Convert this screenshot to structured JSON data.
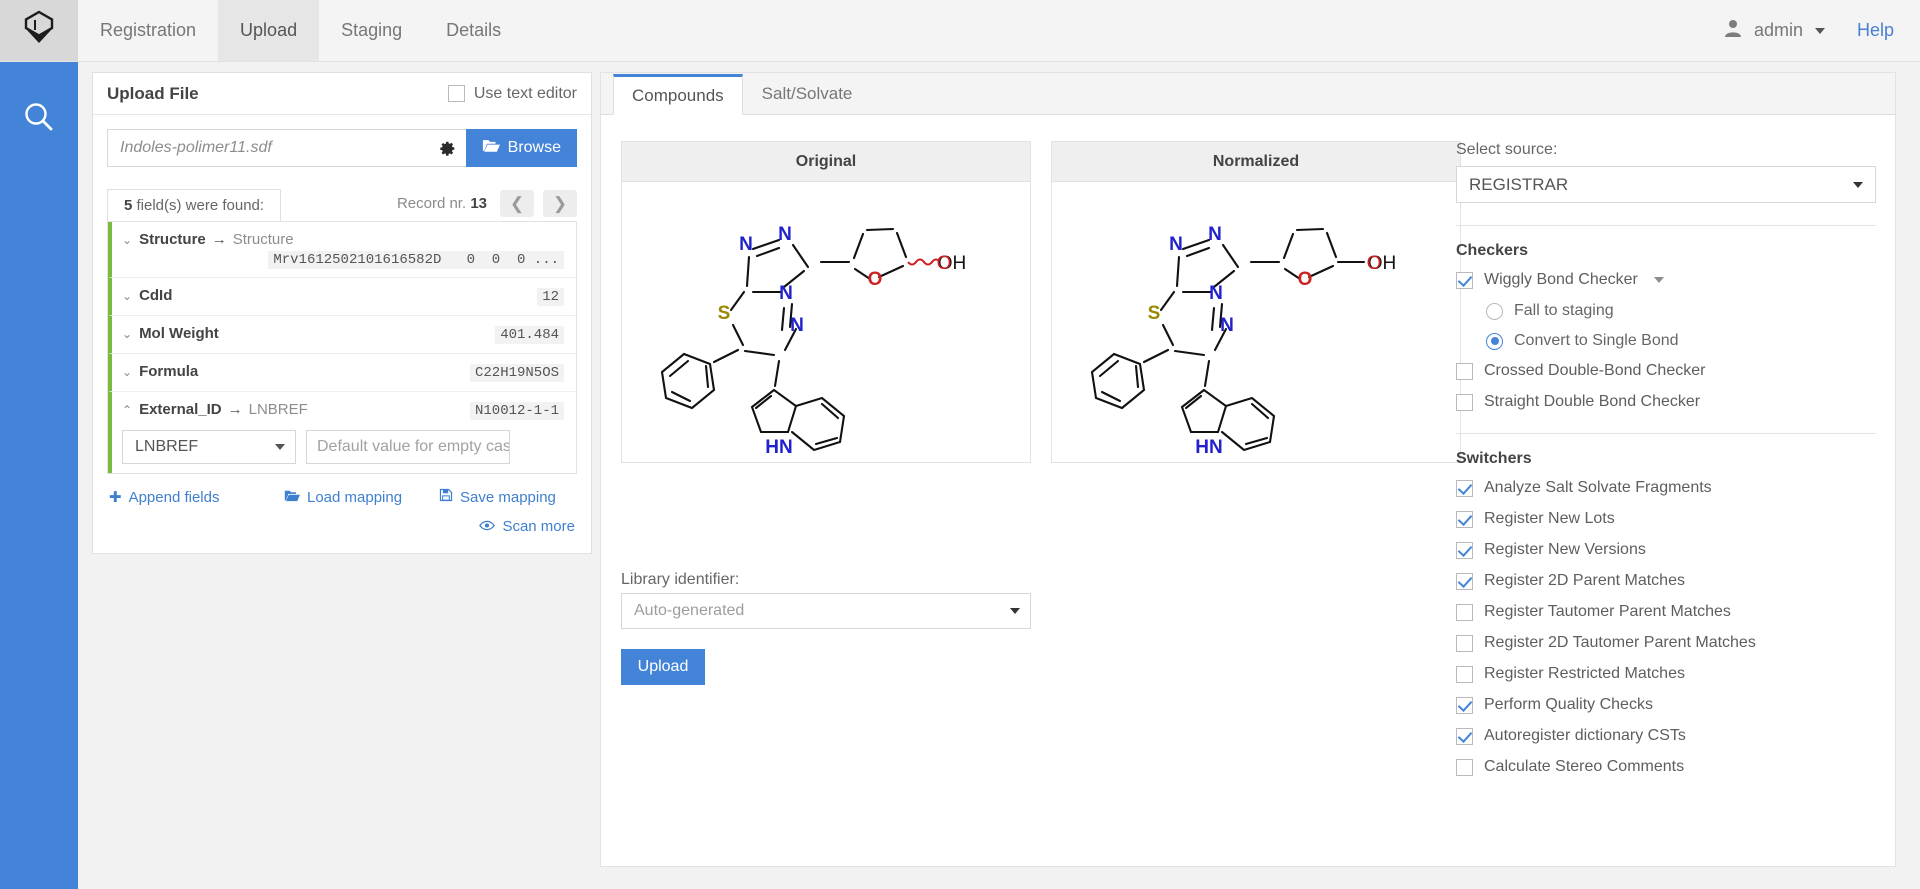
{
  "topbar": {
    "logo_icon": "cube-logo-icon",
    "nav": [
      {
        "label": "Registration",
        "active": false
      },
      {
        "label": "Upload",
        "active": true
      },
      {
        "label": "Staging",
        "active": false
      },
      {
        "label": "Details",
        "active": false
      }
    ],
    "user_icon": "person-icon",
    "user": "admin",
    "help": "Help"
  },
  "rail": {
    "search_icon": "search-icon"
  },
  "upload_card": {
    "title": "Upload File",
    "use_text_editor": {
      "label": "Use text editor",
      "checked": false
    },
    "file": {
      "value": "Indoles-polimer11.sdf",
      "gear_icon": "gear-icon",
      "browse_label": "Browse",
      "browse_icon": "folder-open-icon"
    },
    "field_count_prefix": "5",
    "field_count_suffix": " field(s) were found:",
    "record_label_prefix": "Record nr. ",
    "record_number": "13",
    "prev_icon": "chevron-left-icon",
    "next_icon": "chevron-right-icon",
    "fields": [
      {
        "source": "Structure",
        "arrow": "→",
        "target": "Structure",
        "value": "Mrv1612502101616582D   0  0  0 ...",
        "value_below": true,
        "expanded": false
      },
      {
        "source": "CdId",
        "arrow": "",
        "target": "",
        "value": "12",
        "value_below": false,
        "expanded": false
      },
      {
        "source": "Mol Weight",
        "arrow": "",
        "target": "",
        "value": "401.484",
        "value_below": false,
        "expanded": false
      },
      {
        "source": "Formula",
        "arrow": "",
        "target": "",
        "value": "C22H19N5OS",
        "value_below": false,
        "expanded": false
      }
    ],
    "external_field": {
      "source": "External_ID",
      "arrow": "→",
      "target": "LNBREF",
      "value": "N10012-1-1",
      "select_value": "LNBREF",
      "default_placeholder": "Default value for empty cases"
    },
    "actions": {
      "append": "Append fields",
      "append_icon": "plus-icon",
      "load": "Load mapping",
      "load_icon": "folder-open-icon",
      "save": "Save mapping",
      "save_icon": "floppy-disk-icon",
      "scan": "Scan more",
      "scan_icon": "eye-icon"
    }
  },
  "main_panel": {
    "tabs": [
      {
        "label": "Compounds",
        "active": true
      },
      {
        "label": "Salt/Solvate",
        "active": false
      }
    ],
    "cards": [
      {
        "title": "Original",
        "wiggly": true
      },
      {
        "title": "Normalized",
        "wiggly": false
      }
    ],
    "library": {
      "label": "Library identifier:",
      "value": "Auto-generated"
    },
    "upload_button": "Upload"
  },
  "options": {
    "source": {
      "label": "Select source:",
      "value": "REGISTRAR"
    },
    "checkers_title": "Checkers",
    "checkers": [
      {
        "label": "Wiggly Bond Checker",
        "checked": true,
        "has_caret": true
      },
      {
        "label": "Crossed Double-Bond Checker",
        "checked": false,
        "has_caret": false
      },
      {
        "label": "Straight Double Bond Checker",
        "checked": false,
        "has_caret": false
      }
    ],
    "radios": [
      {
        "label": "Fall to staging",
        "selected": false
      },
      {
        "label": "Convert to Single Bond",
        "selected": true
      }
    ],
    "switchers_title": "Switchers",
    "switchers": [
      {
        "label": "Analyze Salt Solvate Fragments",
        "checked": true
      },
      {
        "label": "Register New Lots",
        "checked": true
      },
      {
        "label": "Register New Versions",
        "checked": true
      },
      {
        "label": "Register 2D Parent Matches",
        "checked": true
      },
      {
        "label": "Register Tautomer Parent Matches",
        "checked": false
      },
      {
        "label": "Register 2D Tautomer Parent Matches",
        "checked": false
      },
      {
        "label": "Register Restricted Matches",
        "checked": false
      },
      {
        "label": "Perform Quality Checks",
        "checked": true
      },
      {
        "label": "Autoregister dictionary CSTs",
        "checked": true
      },
      {
        "label": "Calculate Stereo Comments",
        "checked": false
      }
    ]
  },
  "colors": {
    "accent": "#4484d8",
    "mapping_bar": "#7cbb3f",
    "link": "#3f7fd0",
    "nitrogen": "#2222cc",
    "oxygen": "#cc2222",
    "sulfur": "#998800"
  }
}
